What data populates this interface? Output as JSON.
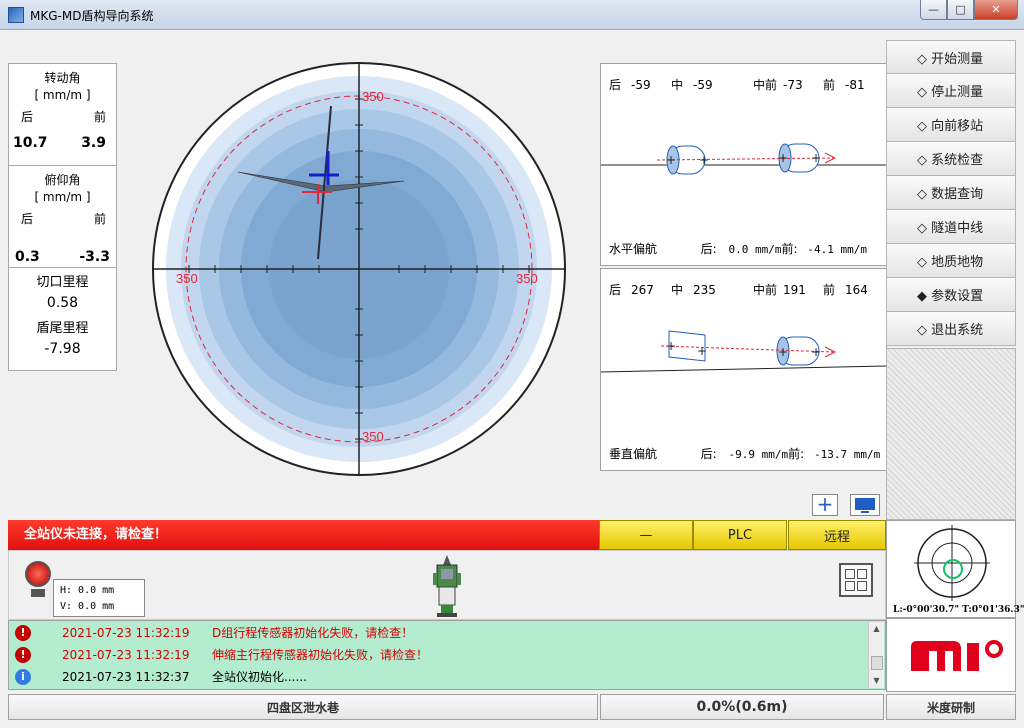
{
  "window": {
    "title": "MKG-MD盾构导向系统",
    "min": "—",
    "max": "□",
    "close": "✕"
  },
  "left_panel": {
    "rotation": {
      "title": "转动角",
      "unit": "[ mm/m ]",
      "rear_label": "后",
      "front_label": "前",
      "rear": "10.7",
      "front": "3.9"
    },
    "pitch": {
      "title": "俯仰角",
      "unit": "[ mm/m ]",
      "rear_label": "后",
      "front_label": "前",
      "rear": "0.3",
      "front": "-3.3"
    },
    "mileage": {
      "cut_label": "切口里程",
      "cut_value": "0.58",
      "tail_label": "盾尾里程",
      "tail_value": "-7.98"
    }
  },
  "target": {
    "top": "350",
    "bottom": "350",
    "left": "350",
    "right": "350"
  },
  "horizontal": {
    "labels": [
      "后",
      "-59",
      "中",
      "-59",
      "中前",
      "-73",
      "前",
      "-81"
    ],
    "title": "水平偏航",
    "rear_label": "后:",
    "rear_val": "0.0 mm/m",
    "front_label": "前:",
    "front_val": "-4.1 mm/m"
  },
  "vertical": {
    "labels": [
      "后",
      "267",
      "中",
      "235",
      "中前",
      "191",
      "前",
      "164"
    ],
    "title": "垂直偏航",
    "rear_label": "后:",
    "rear_val": "-9.9 mm/m",
    "front_label": "前:",
    "front_val": "-13.7 mm/m"
  },
  "menu": [
    "◇ 开始测量",
    "◇ 停止测量",
    "◇ 向前移站",
    "◇ 系统检查",
    "◇ 数据查询",
    "◇ 隧道中线",
    "◇ 地质地物",
    "◆ 参数设置",
    "◇ 退出系统"
  ],
  "status": {
    "alert": "全站仪未连接，请检查！",
    "btn1": "—",
    "btn2": "PLC",
    "btn3": "远程"
  },
  "coords": {
    "h": "H: 0.0 mm",
    "v": "V: 0.0 mm"
  },
  "logs": [
    {
      "type": "error",
      "time": "2021-07-23 11:32:19",
      "msg": "D组行程传感器初始化失败，请检查！",
      "color": "#d40000"
    },
    {
      "type": "error",
      "time": "2021-07-23 11:32:19",
      "msg": "伸缩主行程传感器初始化失败，请检查！",
      "color": "#d40000"
    },
    {
      "type": "info",
      "time": "2021-07-23 11:32:37",
      "msg": "全站仪初始化......",
      "color": "#000000"
    }
  ],
  "bottom": {
    "location": "四盘区泄水巷",
    "progress": "0.0%(0.6m)",
    "brand": "米度研制"
  },
  "mini": {
    "label": "L:-0°00'30.7\" T:0°01'36.3\""
  },
  "colors": {
    "alert_red": "#e81818",
    "button_yellow": "#f2d400",
    "log_green": "#b4ecd0",
    "accent_blue": "#1f5fc2"
  }
}
